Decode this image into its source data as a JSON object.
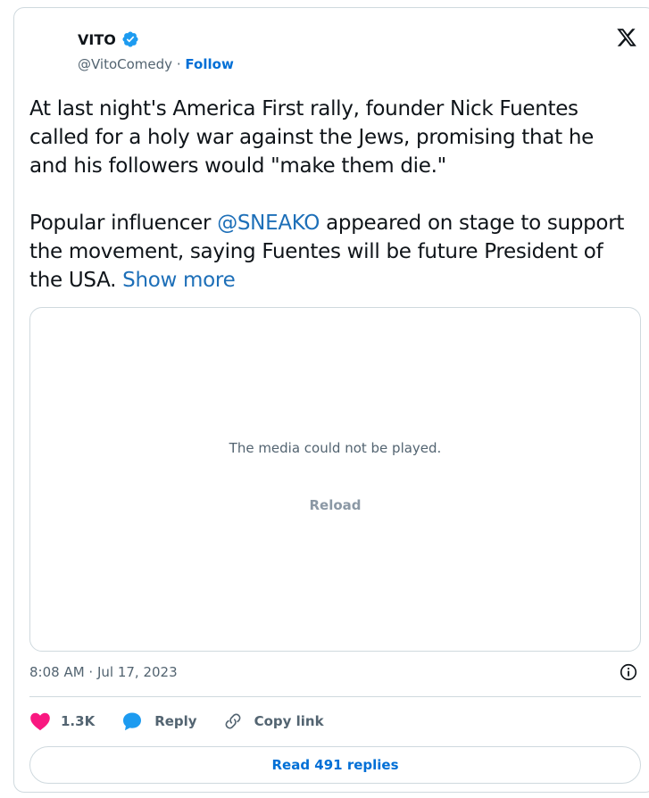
{
  "author": {
    "name": "VITO",
    "handle": "@VitoComedy",
    "separator": "·",
    "follow_label": "Follow"
  },
  "tweet": {
    "paragraph1": "At last night's America First rally, founder Nick Fuentes called for a holy war against the Jews, promising that he and his followers would \"make them die.\"",
    "paragraph2_prefix": "Popular influencer ",
    "mention": "@SNEAKO",
    "paragraph2_suffix": " appeared on stage to support the movement, saying Fuentes will be future President of the USA. ",
    "show_more_label": "Show more"
  },
  "media": {
    "message": "The media could not be played.",
    "reload_label": "Reload"
  },
  "meta": {
    "timestamp": "8:08 AM · Jul 17, 2023"
  },
  "actions": {
    "like_count": "1.3K",
    "reply_label": "Reply",
    "copy_link_label": "Copy link"
  },
  "footer": {
    "read_replies_label": "Read 491 replies"
  },
  "colors": {
    "link": "#1d6fb8",
    "follow": "#006fd6",
    "like": "#f91880",
    "reply": "#1d9bf0",
    "verified": "#1d9bf0"
  },
  "icons": [
    "verified-badge-icon",
    "x-logo-icon",
    "info-icon",
    "heart-icon",
    "reply-bubble-icon",
    "link-icon"
  ]
}
